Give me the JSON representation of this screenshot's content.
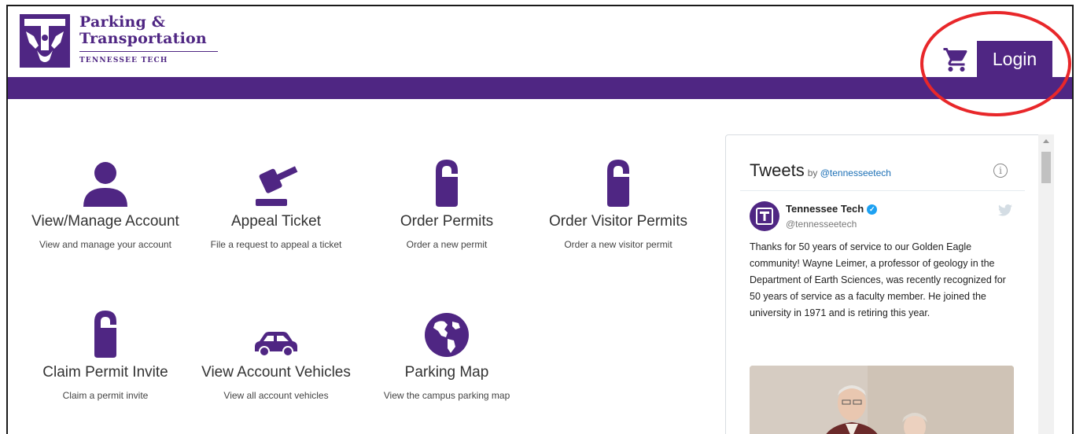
{
  "header": {
    "logo_line1": "Parking &",
    "logo_line2": "Transportation",
    "logo_sub": "TENNESSEE TECH",
    "login_label": "Login"
  },
  "tiles": [
    {
      "title": "View/Manage Account",
      "desc": "View and manage your account",
      "icon": "user-icon"
    },
    {
      "title": "Appeal Ticket",
      "desc": "File a request to appeal a ticket",
      "icon": "gavel-icon"
    },
    {
      "title": "Order Permits",
      "desc": "Order a new permit",
      "icon": "hang-tag-icon"
    },
    {
      "title": "Order Visitor Permits",
      "desc": "Order a new visitor permit",
      "icon": "hang-tag-icon"
    },
    {
      "title": "Claim Permit Invite",
      "desc": "Claim a permit invite",
      "icon": "hang-tag-icon"
    },
    {
      "title": "View Account Vehicles",
      "desc": "View all account vehicles",
      "icon": "car-icon"
    },
    {
      "title": "Parking Map",
      "desc": "View the campus parking map",
      "icon": "globe-icon"
    }
  ],
  "tweets": {
    "heading": "Tweets",
    "by": "by",
    "by_handle": "@tennesseetech",
    "author": "Tennessee Tech",
    "handle": "@tennesseetech",
    "body": "Thanks for 50 years of service to our Golden Eagle community! Wayne Leimer, a professor of geology in the Department of Earth Sciences, was recently recognized for 50 years of service as a faculty member. He joined the university in 1971 and is retiring this year."
  },
  "colors": {
    "brand_purple": "#4f2683",
    "highlight_red": "#e8272a",
    "twitter_blue": "#1da1f2"
  }
}
